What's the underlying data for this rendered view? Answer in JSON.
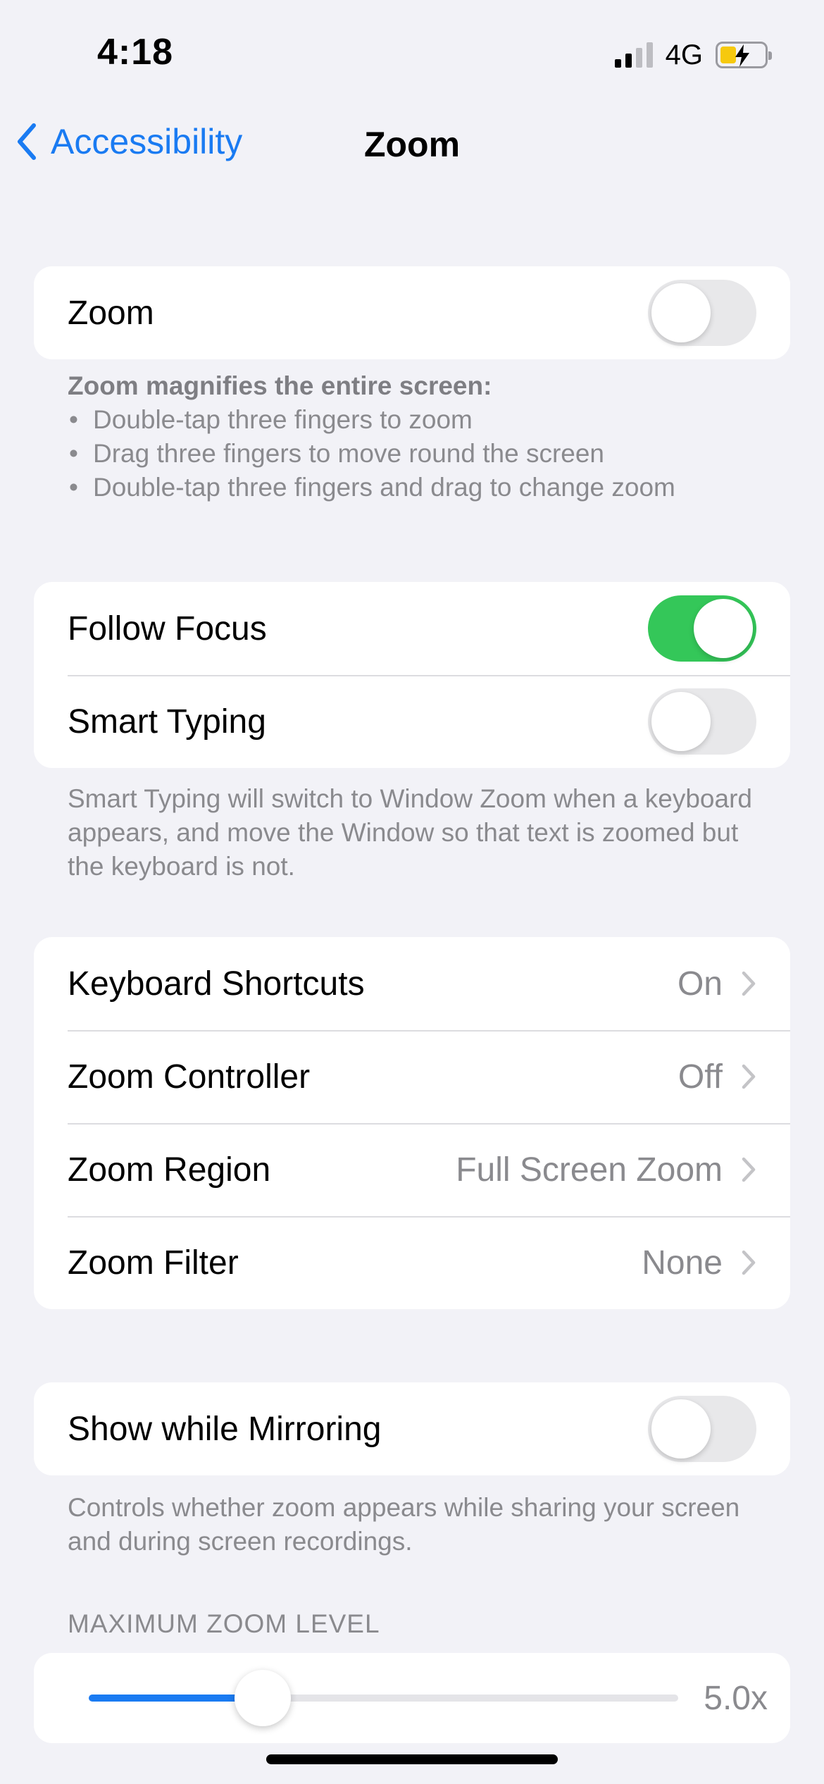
{
  "status_bar": {
    "time": "4:18",
    "network": "4G",
    "signal_bars": 2,
    "battery_color": "#f6c90e",
    "charging": true
  },
  "nav": {
    "back_label": "Accessibility",
    "title": "Zoom"
  },
  "zoom_group": {
    "label": "Zoom",
    "enabled": false
  },
  "zoom_footer": {
    "heading": "Zoom magnifies the entire screen:",
    "bullets": [
      "Double-tap three fingers to zoom",
      "Drag three fingers to move round the screen",
      "Double-tap three fingers and drag to change zoom"
    ]
  },
  "focus_group": {
    "follow_focus": {
      "label": "Follow Focus",
      "enabled": true
    },
    "smart_typing": {
      "label": "Smart Typing",
      "enabled": false
    }
  },
  "smart_typing_footer": "Smart Typing will switch to Window Zoom when a keyboard appears, and move the Window so that text is zoomed but the keyboard is not.",
  "options_group": [
    {
      "label": "Keyboard Shortcuts",
      "value": "On"
    },
    {
      "label": "Zoom Controller",
      "value": "Off"
    },
    {
      "label": "Zoom Region",
      "value": "Full Screen Zoom"
    },
    {
      "label": "Zoom Filter",
      "value": "None"
    }
  ],
  "mirroring_group": {
    "label": "Show while Mirroring",
    "enabled": false
  },
  "mirroring_footer": "Controls whether zoom appears while sharing your screen and during screen recordings.",
  "max_zoom": {
    "header": "MAXIMUM ZOOM LEVEL",
    "value_label": "5.0x",
    "level_fraction": 0.295
  },
  "colors": {
    "accent": "#1a7bf2",
    "toggle_on": "#34c759",
    "background": "#f2f2f7"
  }
}
